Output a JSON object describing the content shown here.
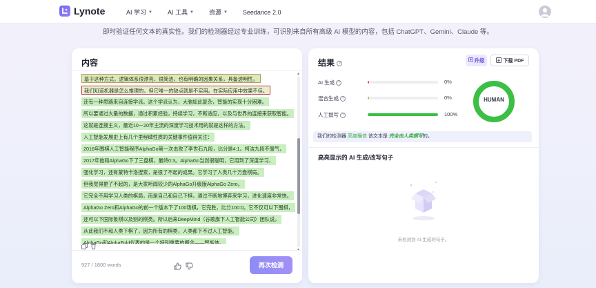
{
  "nav": {
    "brand": "Lynote",
    "items": [
      {
        "label": "AI 学习",
        "has_caret": true
      },
      {
        "label": "AI 工具",
        "has_caret": true
      },
      {
        "label": "资源",
        "has_caret": true
      },
      {
        "label": "Seedance 2.0",
        "has_caret": false
      }
    ],
    "user_icon": "user-avatar-icon"
  },
  "subtitle": "即时验证任何文本的真实性。我们的检测器经过专业训练，可识别来自所有高级 AI 模型的内容，包括 ChatGPT、Gemini、Claude 等。",
  "content": {
    "title": "内容",
    "lines": [
      {
        "text": "基于这种方式，逻辑体系很漂亮、很简洁，也有明确的因果关系，具备透明性。",
        "style": "olive"
      },
      {
        "text": "我们知道机器是怎么推理的，但它唯一的缺点就是不实用。在实际应用中效果不佳。",
        "style": "pink"
      },
      {
        "text": "还有一种思路来自连接学派。这个学派认为，大脑如此复杂，智能的实现十分困难。",
        "style": "green"
      },
      {
        "text": "所以要通过大量的数据，通过积累经验，持续学习，不断适应，以及与世界的连接来获取智能。",
        "style": "green"
      },
      {
        "text": "这就是连接主义，最近10－20年主流的深度学习技术用的就是这样的方法。",
        "style": "green"
      },
      {
        "text": "人工智能发展史上有几个里程碑性质的关键事件值得关注：",
        "style": "green"
      },
      {
        "text": "2016年围棋人工智能程序AlphaGo第一次击败了李世石九段，比分是4:1。柯洁九段不服气，",
        "style": "green"
      },
      {
        "text": "2017年他和AlphaGo下了三盘棋，最终0:3。AlphaGo当然很聪明，它用到了深度学习、",
        "style": "green"
      },
      {
        "text": "强化学习，还有蒙特卡洛搜索，是很了不起的成果。它学习了人类几十万盘棋局。",
        "style": "green"
      },
      {
        "text": "但我觉得更了不起的，是大家听闻较少的AlphaGo升级版AlphaGo Zero。",
        "style": "green"
      },
      {
        "text": "它完全不用学习人类的棋局，而是自己和自己下棋，通过不断地博弈来学习，进化速度非常快。",
        "style": "green"
      },
      {
        "text": "AlphaGo Zero和AlphaGo的前一个版本下了100场棋，它完胜，比分100:0。它不仅可以下围棋，",
        "style": "green"
      },
      {
        "text": "还可以下国际象棋以及别的棋类。所以后来DeepMind（谷歌旗下人工智能公司）团队说，",
        "style": "green"
      },
      {
        "text": "从此我们不和人类下棋了，因为所有的棋类，人类都下不过人工智能。",
        "style": "green"
      },
      {
        "text": "AlphaGo和AlphaFold代表的是一个特别重要的概念——智能体。",
        "style": "green"
      }
    ],
    "word_count": "927 / 1800 words",
    "recheck_label": "再次检测"
  },
  "results": {
    "title": "结果",
    "upgrade_label": "升级",
    "download_label": "下载 PDF",
    "stats": [
      {
        "label": "AI 生成",
        "percent": 0,
        "value_label": "0%",
        "color": "#e04a5a"
      },
      {
        "label": "混合生成",
        "percent": 0,
        "value_label": "0%",
        "color": "#e0a84a"
      },
      {
        "label": "人工撰写",
        "percent": 100,
        "value_label": "100%",
        "color": "#3cbf45"
      }
    ],
    "verdict_prefix": "我们的检测器",
    "verdict_conf": "高度确信",
    "verdict_mid": "该文本是",
    "verdict_result": "完全由人类撰写",
    "verdict_suffix": "的。",
    "donut_label": "HUMAN",
    "donut_color": "#3cbf45",
    "sentences_title": "高亮显示的 AI 生成/改写句子",
    "empty_text": "未检测到 AI 生成的句子。"
  }
}
